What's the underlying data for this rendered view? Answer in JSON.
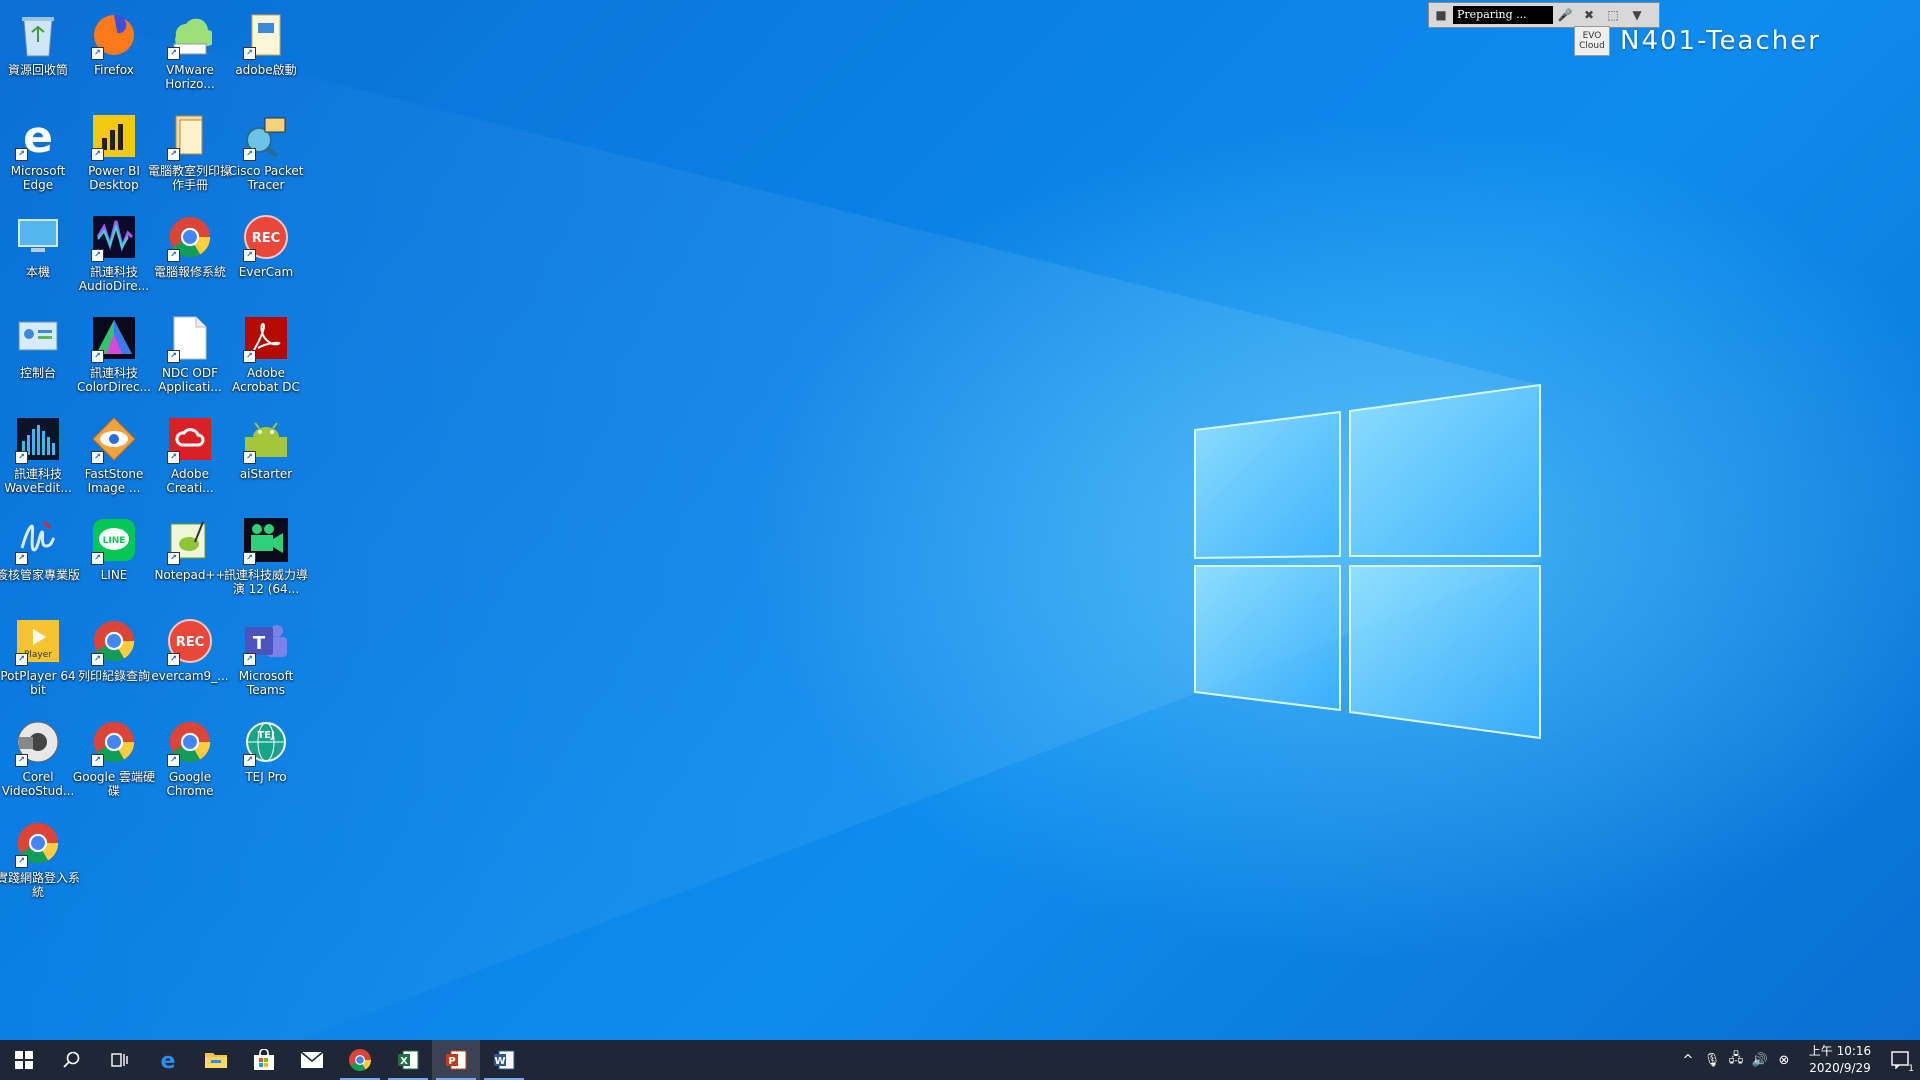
{
  "desktop_icons": [
    {
      "label": "資源回收筒",
      "icon": "recycle-bin-icon",
      "shortcut": false
    },
    {
      "label": "Firefox",
      "icon": "firefox-icon",
      "shortcut": true
    },
    {
      "label": "VMware Horizo...",
      "icon": "vmware-horizon-icon",
      "shortcut": true
    },
    {
      "label": "adobe啟動",
      "icon": "folder-icon",
      "shortcut": true
    },
    {
      "label": "Microsoft Edge",
      "icon": "edge-icon",
      "shortcut": true
    },
    {
      "label": "Power BI Desktop",
      "icon": "power-bi-icon",
      "shortcut": true
    },
    {
      "label": "電腦教室列印操作手冊",
      "icon": "document-folder-icon",
      "shortcut": true
    },
    {
      "label": "Cisco Packet Tracer",
      "icon": "cisco-packet-tracer-icon",
      "shortcut": true
    },
    {
      "label": "本機",
      "icon": "this-pc-icon",
      "shortcut": false
    },
    {
      "label": "訊連科技 AudioDire...",
      "icon": "audiodirector-icon",
      "shortcut": true
    },
    {
      "label": "電腦報修系統",
      "icon": "chrome-icon",
      "shortcut": true
    },
    {
      "label": "EverCam",
      "icon": "evercam-rec-icon",
      "shortcut": true
    },
    {
      "label": "控制台",
      "icon": "control-panel-icon",
      "shortcut": false
    },
    {
      "label": "訊連科技 ColorDirec...",
      "icon": "colordirector-icon",
      "shortcut": true
    },
    {
      "label": "NDC ODF Applicati...",
      "icon": "blank-file-icon",
      "shortcut": true
    },
    {
      "label": "Adobe Acrobat DC",
      "icon": "acrobat-icon",
      "shortcut": true
    },
    {
      "label": "訊連科技 WaveEdit...",
      "icon": "waveeditor-icon",
      "shortcut": true
    },
    {
      "label": "FastStone Image ...",
      "icon": "faststone-eye-icon",
      "shortcut": true
    },
    {
      "label": "Adobe Creati...",
      "icon": "creative-cloud-icon",
      "shortcut": true
    },
    {
      "label": "aiStarter",
      "icon": "android-icon",
      "shortcut": true
    },
    {
      "label": "簽核管家專業版",
      "icon": "signature-icon",
      "shortcut": true
    },
    {
      "label": "LINE",
      "icon": "line-icon",
      "shortcut": true
    },
    {
      "label": "Notepad++",
      "icon": "notepad-plus-icon",
      "shortcut": true
    },
    {
      "label": "訊連科技威力導演 12 (64...",
      "icon": "powerdirector-icon",
      "shortcut": true
    },
    {
      "label": "PotPlayer 64 bit",
      "icon": "potplayer-icon",
      "shortcut": true
    },
    {
      "label": "列印紀錄查詢",
      "icon": "chrome-icon",
      "shortcut": true
    },
    {
      "label": "evercam9_...",
      "icon": "evercam-rec-icon",
      "shortcut": true
    },
    {
      "label": "Microsoft Teams",
      "icon": "teams-icon",
      "shortcut": true
    },
    {
      "label": "Corel VideoStud...",
      "icon": "videostudio-icon",
      "shortcut": true
    },
    {
      "label": "Google 雲端硬碟",
      "icon": "chrome-icon",
      "shortcut": true
    },
    {
      "label": "Google Chrome",
      "icon": "chrome-icon",
      "shortcut": true
    },
    {
      "label": "TEJ Pro",
      "icon": "tej-globe-icon",
      "shortcut": true
    },
    {
      "label": "實踐網路登入系統",
      "icon": "chrome-icon",
      "shortcut": true
    }
  ],
  "recorder": {
    "status": "Preparing ..."
  },
  "host": {
    "logo_line1": "EVO",
    "logo_line2": "Cloud",
    "name": "N401-Teacher"
  },
  "taskbar": {
    "items": [
      {
        "name": "start-button",
        "icon": "windows-logo-icon"
      },
      {
        "name": "search-button",
        "icon": "search-icon"
      },
      {
        "name": "task-view-button",
        "icon": "task-view-icon"
      },
      {
        "name": "edge-taskbar-button",
        "icon": "edge-icon"
      },
      {
        "name": "file-explorer-taskbar-button",
        "icon": "folder-icon"
      },
      {
        "name": "store-taskbar-button",
        "icon": "store-bag-icon"
      },
      {
        "name": "mail-taskbar-button",
        "icon": "mail-icon"
      },
      {
        "name": "chrome-taskbar-button",
        "icon": "chrome-icon"
      },
      {
        "name": "excel-taskbar-button",
        "icon": "excel-icon"
      },
      {
        "name": "powerpoint-taskbar-button",
        "icon": "powerpoint-icon"
      },
      {
        "name": "word-taskbar-button",
        "icon": "word-icon"
      }
    ]
  },
  "tray": {
    "time": "上午 10:16",
    "date": "2020/9/29",
    "notification_count": "1"
  },
  "colors": {
    "accent": "#0b82e6",
    "taskbar": "#1f2736"
  }
}
